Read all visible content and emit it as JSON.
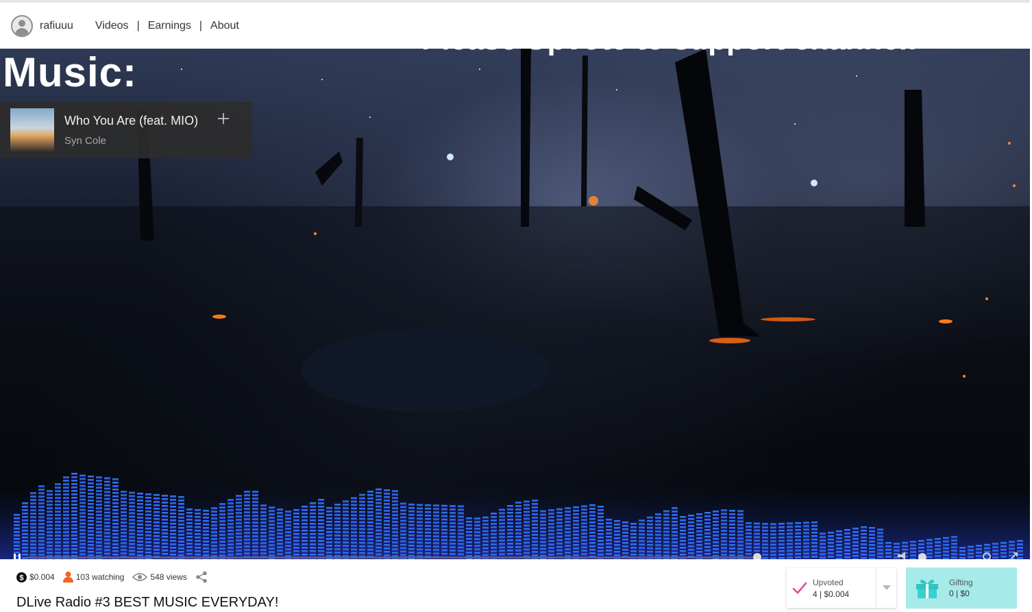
{
  "header": {
    "username": "rafiuuu",
    "nav": [
      {
        "label": "Videos"
      },
      {
        "label": "Earnings"
      },
      {
        "label": "About"
      }
    ],
    "separator": "|"
  },
  "video": {
    "overlay_title": "Music:",
    "overlay_banner": "Please Upvote to support channel!",
    "now_playing": {
      "title": "Who You Are (feat. MIO)",
      "artist": "Syn Cole"
    }
  },
  "stats": {
    "earnings": "$0.004",
    "watching": "103 watching",
    "views": "548 views"
  },
  "video_title": "DLive Radio #3 BEST MUSIC EVERYDAY!",
  "upvote": {
    "label": "Upvoted",
    "stats": "4 | $0.004"
  },
  "gift": {
    "label": "Gifting",
    "stats": "0 | $0"
  },
  "colors": {
    "upvote_check": "#e8489c",
    "gift_bg": "#a6eaea",
    "gift_icon": "#2ec4c4",
    "viewer_icon": "#f26522",
    "visualizer": "#2a8cff"
  }
}
